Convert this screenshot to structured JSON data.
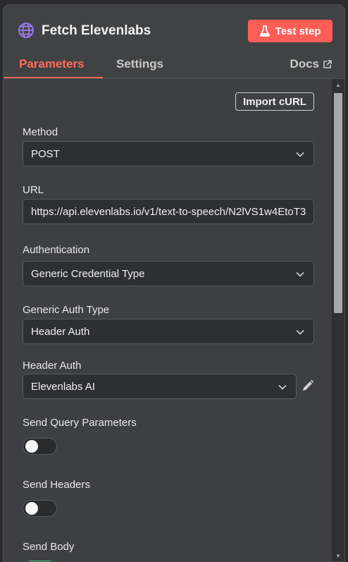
{
  "node": {
    "title": "Fetch Elevenlabs",
    "test_step_label": "Test step"
  },
  "tabs": {
    "parameters": "Parameters",
    "settings": "Settings",
    "docs": "Docs"
  },
  "form": {
    "import_curl_label": "Import cURL",
    "method": {
      "label": "Method",
      "value": "POST"
    },
    "url": {
      "label": "URL",
      "value": "https://api.elevenlabs.io/v1/text-to-speech/N2lVS1w4EtoT3"
    },
    "authentication": {
      "label": "Authentication",
      "value": "Generic Credential Type"
    },
    "generic_auth_type": {
      "label": "Generic Auth Type",
      "value": "Header Auth"
    },
    "header_auth": {
      "label": "Header Auth",
      "value": "Elevenlabs AI"
    },
    "send_query_parameters": {
      "label": "Send Query Parameters",
      "enabled": false
    },
    "send_headers": {
      "label": "Send Headers",
      "enabled": false
    },
    "send_body": {
      "label": "Send Body",
      "enabled": true
    }
  },
  "colors": {
    "accent": "#ff6b5b",
    "test_button": "#ff5e57",
    "toggle_on": "#3ec37a",
    "globe_icon": "#9b7bf0"
  }
}
